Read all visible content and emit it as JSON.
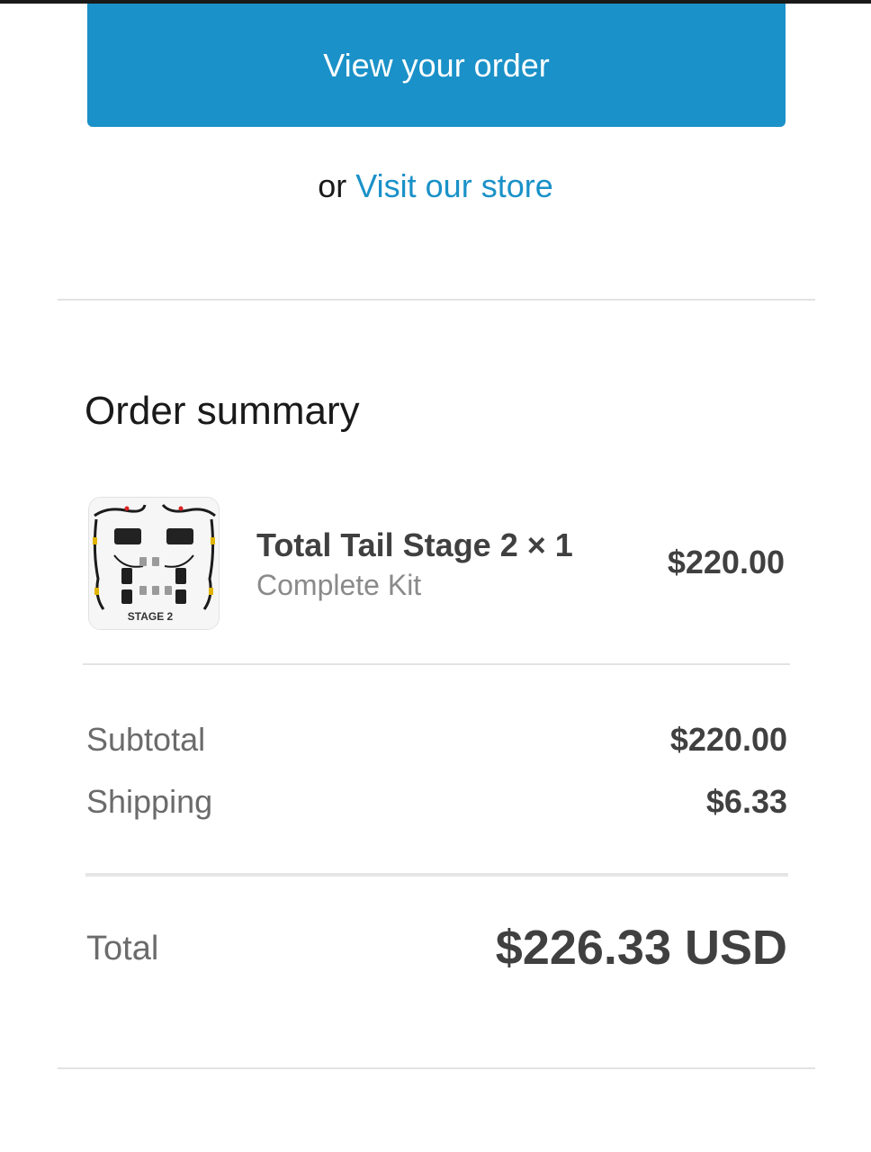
{
  "actions": {
    "view_order_label": "View your order",
    "or_text": "or",
    "visit_store_label": "Visit our store"
  },
  "order_summary": {
    "title": "Order summary",
    "items": [
      {
        "name": "Total Tail Stage 2 × 1",
        "variant": "Complete Kit",
        "price": "$220.00",
        "image_label": "STAGE 2"
      }
    ],
    "subtotal_label": "Subtotal",
    "subtotal_value": "$220.00",
    "shipping_label": "Shipping",
    "shipping_value": "$6.33",
    "total_label": "Total",
    "total_value": "$226.33 USD"
  },
  "colors": {
    "accent": "#1a91c8",
    "text_dark": "#404040",
    "text_muted": "#6b6b6b"
  }
}
